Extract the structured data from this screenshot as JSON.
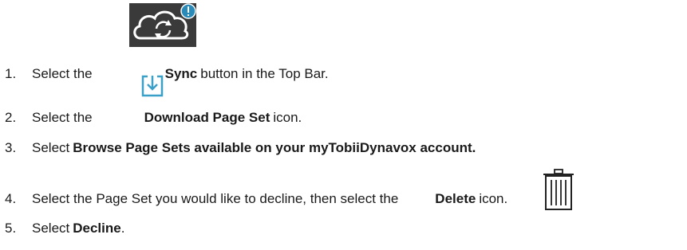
{
  "steps": [
    {
      "num": "1.",
      "pre": "Select the",
      "bold": "Sync",
      "post": "button in the Top Bar."
    },
    {
      "num": "2.",
      "pre": "Select the",
      "bold": "Download Page Set",
      "post": "icon."
    },
    {
      "num": "3.",
      "pre": "Select",
      "bold": "Browse Page Sets available on your myTobiiDynavox account.",
      "post": ""
    },
    {
      "num": "4.",
      "pre": "Select the Page Set you would like to decline, then select the",
      "bold": "Delete",
      "post": "icon."
    },
    {
      "num": "5.",
      "pre": "Select",
      "bold": "Decline",
      "post": "."
    }
  ],
  "icons": {
    "sync": "sync-icon",
    "download": "download-icon",
    "delete": "trash-icon",
    "badge_color": "#2a8ab8",
    "download_color": "#3aa0c8"
  }
}
